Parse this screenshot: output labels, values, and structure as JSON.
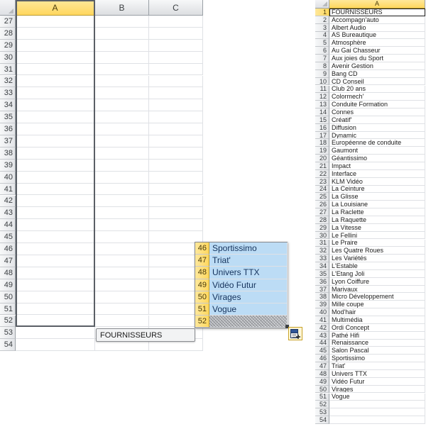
{
  "app": {
    "kind": "spreadsheet",
    "accent_selected_header": "#ffd75e",
    "accent_selection_fill": "#bcdcf5",
    "grid_line_color": "#dfe1e5"
  },
  "left_sheet": {
    "name": "left-worksheet",
    "select_all_label": "",
    "columns": [
      {
        "label": "A",
        "selected": true
      },
      {
        "label": "B",
        "selected": false
      },
      {
        "label": "C",
        "selected": false
      }
    ],
    "row_headers": [
      "27",
      "28",
      "29",
      "30",
      "31",
      "32",
      "33",
      "34",
      "35",
      "36",
      "37",
      "38",
      "39",
      "40",
      "41",
      "42",
      "43",
      "44",
      "45",
      "46",
      "47",
      "48",
      "49",
      "50",
      "51",
      "52",
      "53",
      "54"
    ],
    "selected_column": "A",
    "selection_range_rows": [
      "27",
      "52"
    ],
    "cells": []
  },
  "drag_overlay": {
    "name": "drag-selection-overlay",
    "rows": [
      {
        "header": "46",
        "value": "Sportissimo",
        "state": "selected"
      },
      {
        "header": "47",
        "value": "Triat'",
        "state": "selected"
      },
      {
        "header": "48",
        "value": "Univers TTX",
        "state": "selected"
      },
      {
        "header": "49",
        "value": "Vidéo Futur",
        "state": "selected"
      },
      {
        "header": "50",
        "value": "Virages",
        "state": "selected"
      },
      {
        "header": "51",
        "value": "Vogue",
        "state": "selected"
      },
      {
        "header": "52",
        "value": "",
        "state": "hatched"
      }
    ]
  },
  "paste_preview": {
    "name": "paste-preview-bubble",
    "value": "FOURNISSEURS"
  },
  "paste_options": {
    "name": "paste-options-button",
    "icon": "paste-options-icon",
    "label": ""
  },
  "right_sheet": {
    "name": "right-worksheet",
    "columns": [
      {
        "label": "A",
        "selected": true
      }
    ],
    "active_cell": {
      "row": "1",
      "value": "FOURNISSEURS"
    },
    "rows": [
      {
        "header": "1",
        "value": "FOURNISSEURS"
      },
      {
        "header": "2",
        "value": "Accompagn'auto"
      },
      {
        "header": "3",
        "value": "Albert Audio"
      },
      {
        "header": "4",
        "value": "AS Bureautique"
      },
      {
        "header": "5",
        "value": "Atmosphère"
      },
      {
        "header": "6",
        "value": "Au Gai Chasseur"
      },
      {
        "header": "7",
        "value": "Aux joies du Sport"
      },
      {
        "header": "8",
        "value": "Avenir Gestion"
      },
      {
        "header": "9",
        "value": "Bang CD"
      },
      {
        "header": "10",
        "value": "CD Conseil"
      },
      {
        "header": "11",
        "value": "Club 20 ans"
      },
      {
        "header": "12",
        "value": "Colormech'"
      },
      {
        "header": "13",
        "value": "Conduite Formation"
      },
      {
        "header": "14",
        "value": "Connes"
      },
      {
        "header": "15",
        "value": "Créatif'"
      },
      {
        "header": "16",
        "value": "Diffusion"
      },
      {
        "header": "17",
        "value": "Dynamic"
      },
      {
        "header": "18",
        "value": "Européenne de conduite"
      },
      {
        "header": "19",
        "value": "Gaumont"
      },
      {
        "header": "20",
        "value": "Géantissimo"
      },
      {
        "header": "21",
        "value": "Impact"
      },
      {
        "header": "22",
        "value": "Interface"
      },
      {
        "header": "23",
        "value": "KLM Vidéo"
      },
      {
        "header": "24",
        "value": "La Ceinture"
      },
      {
        "header": "25",
        "value": "La Glisse"
      },
      {
        "header": "26",
        "value": "La Louisiane"
      },
      {
        "header": "27",
        "value": "La Raclette"
      },
      {
        "header": "28",
        "value": "La Raquette"
      },
      {
        "header": "29",
        "value": "La Vitesse"
      },
      {
        "header": "30",
        "value": "Le Fellini"
      },
      {
        "header": "31",
        "value": "Le Praire"
      },
      {
        "header": "32",
        "value": "Les Quatre Roues"
      },
      {
        "header": "33",
        "value": "Les Variétés"
      },
      {
        "header": "34",
        "value": "L'Estable"
      },
      {
        "header": "35",
        "value": "L'Etang Joli"
      },
      {
        "header": "36",
        "value": "Lyon Coiffure"
      },
      {
        "header": "37",
        "value": "Marivaux"
      },
      {
        "header": "38",
        "value": "Micro Développement"
      },
      {
        "header": "39",
        "value": "Mille coupe"
      },
      {
        "header": "40",
        "value": "Mod'hair"
      },
      {
        "header": "41",
        "value": "Multimédia"
      },
      {
        "header": "42",
        "value": "Ordi Concept"
      },
      {
        "header": "43",
        "value": "Pathé Hifi"
      },
      {
        "header": "44",
        "value": "Renaissance"
      },
      {
        "header": "45",
        "value": "Salon Pascal"
      },
      {
        "header": "46",
        "value": "Sportissimo"
      },
      {
        "header": "47",
        "value": "Triat'"
      },
      {
        "header": "48",
        "value": "Univers TTX"
      },
      {
        "header": "49",
        "value": "Vidéo Futur"
      },
      {
        "header": "50",
        "value": "Virages"
      },
      {
        "header": "51",
        "value": "Vogue"
      },
      {
        "header": "52",
        "value": ""
      },
      {
        "header": "53",
        "value": ""
      },
      {
        "header": "54",
        "value": ""
      }
    ]
  }
}
